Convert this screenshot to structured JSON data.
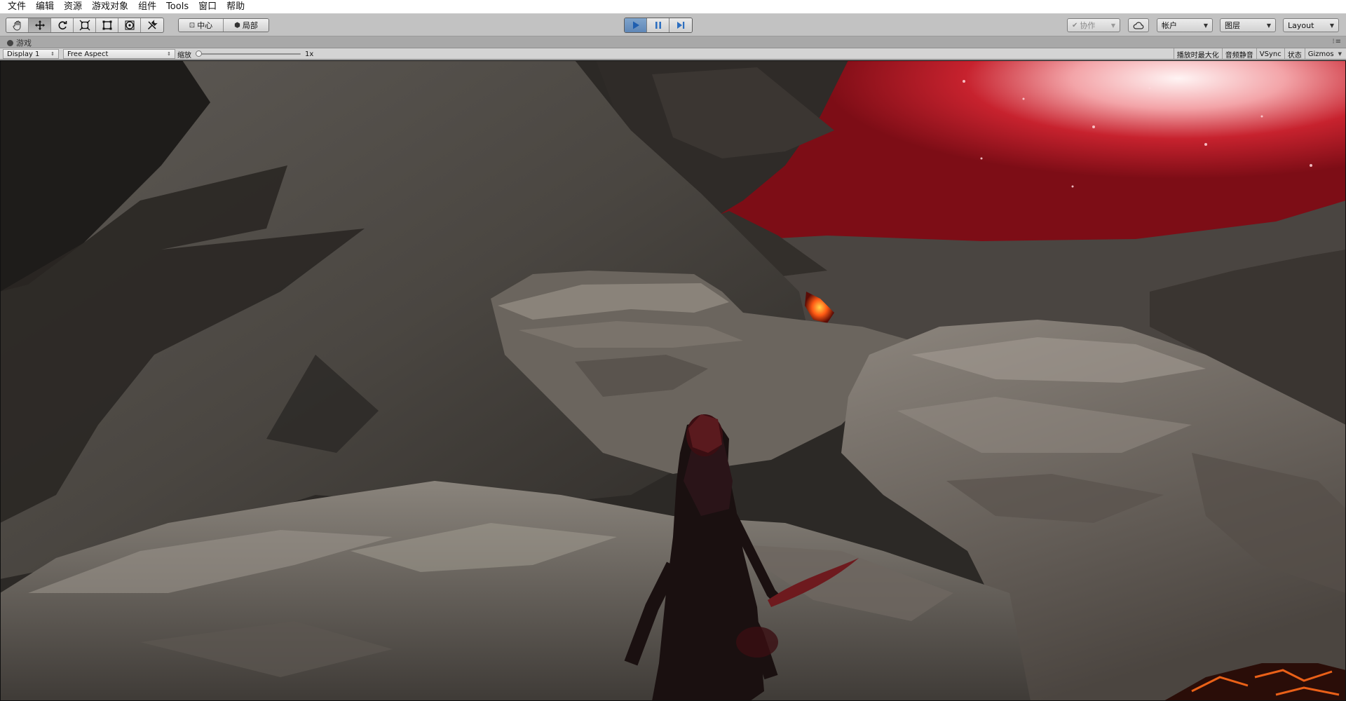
{
  "menu": [
    "文件",
    "编辑",
    "资源",
    "游戏对象",
    "组件",
    "Tools",
    "窗口",
    "帮助"
  ],
  "toolbar": {
    "tools": [
      {
        "name": "hand",
        "icon": "hand-icon"
      },
      {
        "name": "move",
        "icon": "move-arrows-icon"
      },
      {
        "name": "rotate",
        "icon": "rotate-icon"
      },
      {
        "name": "scale",
        "icon": "scale-icon"
      },
      {
        "name": "rect",
        "icon": "rect-tool-icon"
      },
      {
        "name": "transform",
        "icon": "transform-icon"
      },
      {
        "name": "custom",
        "icon": "custom-tool-icon"
      }
    ],
    "active_tool": "move",
    "pivot_label": "中心",
    "space_label": "局部",
    "play_active": true,
    "collab_label": "协作",
    "account_label": "帐户",
    "layers_label": "图层",
    "layout_label": "Layout"
  },
  "tab": {
    "title": "游戏"
  },
  "game_view": {
    "display": "Display 1",
    "aspect": "Free Aspect",
    "scale_label": "缩放",
    "scale_value": "1x",
    "scale_slider": 0.0,
    "toggles": [
      "播放时最大化",
      "音频静音",
      "VSync",
      "状态",
      "Gizmos"
    ]
  },
  "colors": {
    "play_active": "#5f87b7",
    "sky_red": "#a8121e",
    "rock": "#6e6760",
    "lava": "#ff5a14"
  }
}
